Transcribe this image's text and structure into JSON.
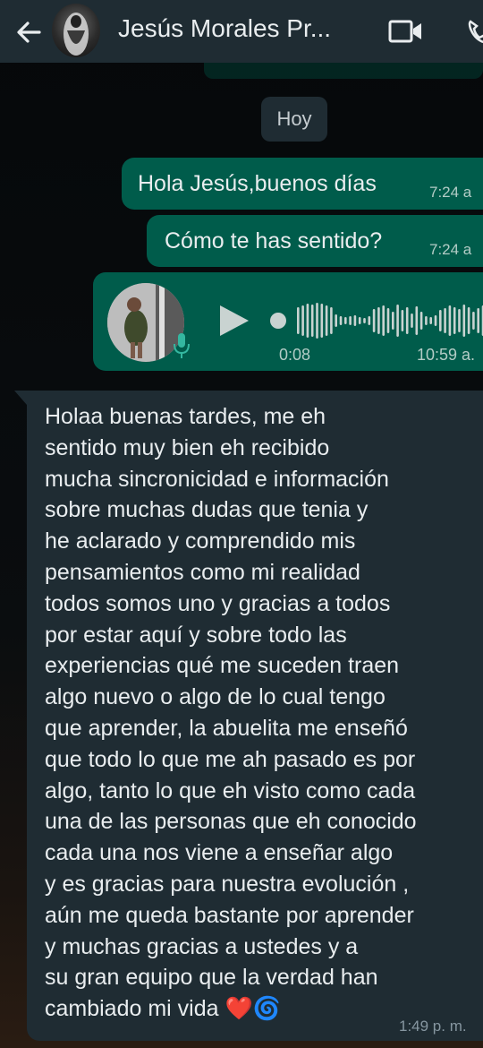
{
  "header": {
    "title": "Jesús Morales Pr..."
  },
  "chat": {
    "date_chip": "Hoy",
    "messages": [
      {
        "type": "text",
        "direction": "outgoing",
        "text": "Hola Jesús,buenos días",
        "time": "7:24 a"
      },
      {
        "type": "text",
        "direction": "outgoing",
        "text": "Cómo te has sentido?",
        "time": "7:24 a"
      },
      {
        "type": "voice",
        "direction": "outgoing",
        "duration": "0:08",
        "time": "10:59 a."
      },
      {
        "type": "text",
        "direction": "incoming",
        "text": "Holaa buenas tardes, me eh\nsentido muy bien eh recibido\nmucha sincronicidad e información\nsobre muchas dudas que tenia y\nhe aclarado y comprendido mis\npensamientos como mi realidad\ntodos somos uno y gracias a todos\npor estar aquí y sobre todo las\nexperiencias qué me suceden traen\nalgo nuevo o algo de lo cual tengo\nque aprender, la abuelita me enseñó\nque todo lo que me ah pasado es por\nalgo, tanto lo que eh visto como cada\nuna de las personas que eh conocido\ncada una nos viene a enseñar algo\ny es gracias para nuestra evolución ,\naún me queda bastante por aprender\ny muchas gracias a ustedes y a\nsu gran equipo que la verdad han\ncambiado mi vida ❤️🌀",
        "time": "1:49 p. m."
      }
    ]
  },
  "icons": {
    "back": "arrow-left-icon",
    "video": "video-camera-icon",
    "call": "phone-icon",
    "play": "play-icon",
    "mic": "microphone-icon"
  },
  "colors": {
    "header_bg": "#1f2c33",
    "outgoing_bubble": "#005c4b",
    "incoming_bubble": "#1f2c33",
    "text": "#e9edef"
  }
}
